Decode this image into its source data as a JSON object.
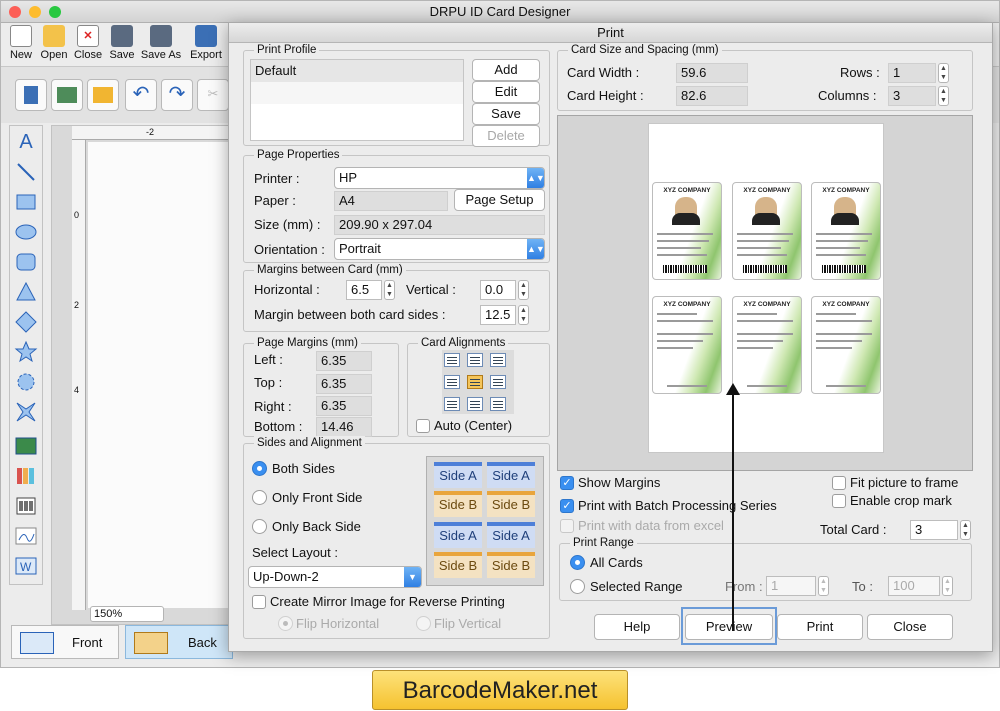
{
  "app": {
    "title": "DRPU ID Card Designer",
    "toolbar": [
      "New",
      "Open",
      "Close",
      "Save",
      "Save As",
      "Export"
    ],
    "ruler_labels": [
      "-2",
      "0",
      "2",
      "4"
    ],
    "zoom": "150%",
    "tabs": {
      "front": "Front",
      "back": "Back"
    }
  },
  "dialog": {
    "title": "Print",
    "print_profile": {
      "legend": "Print Profile",
      "items": [
        "Default"
      ],
      "buttons": {
        "add": "Add",
        "edit": "Edit",
        "save": "Save",
        "delete": "Delete"
      }
    },
    "page_properties": {
      "legend": "Page Properties",
      "printer_label": "Printer :",
      "printer": "HP",
      "paper_label": "Paper :",
      "paper": "A4",
      "page_setup": "Page Setup",
      "size_label": "Size (mm) :",
      "size": "209.90 x 297.04",
      "orientation_label": "Orientation :",
      "orientation": "Portrait"
    },
    "margins_between": {
      "legend": "Margins between Card (mm)",
      "horizontal_label": "Horizontal :",
      "horizontal": "6.5",
      "vertical_label": "Vertical :",
      "vertical": "0.0",
      "both_sides_label": "Margin between both card sides :",
      "both_sides": "12.5"
    },
    "page_margins": {
      "legend": "Page Margins (mm)",
      "left_label": "Left :",
      "left": "6.35",
      "top_label": "Top :",
      "top": "6.35",
      "right_label": "Right :",
      "right": "6.35",
      "bottom_label": "Bottom :",
      "bottom": "14.46"
    },
    "card_alignments": {
      "legend": "Card Alignments",
      "auto_center": "Auto (Center)",
      "selected_index": 4
    },
    "sides": {
      "legend": "Sides and Alignment",
      "both": "Both Sides",
      "front_only": "Only Front Side",
      "back_only": "Only Back Side",
      "selected": "both",
      "layout_label": "Select Layout :",
      "layout": "Up-Down-2",
      "preview_cells": [
        "Side A",
        "Side A",
        "Side B",
        "Side B",
        "Side A",
        "Side A",
        "Side B",
        "Side B"
      ],
      "mirror_label": "Create Mirror Image for Reverse Printing",
      "flip_h": "Flip Horizontal",
      "flip_v": "Flip Vertical"
    },
    "card_size": {
      "legend": "Card Size and Spacing (mm)",
      "width_label": "Card Width :",
      "width": "59.6",
      "height_label": "Card Height :",
      "height": "82.6",
      "rows_label": "Rows :",
      "rows": "1",
      "columns_label": "Columns :",
      "columns": "3"
    },
    "preview_cards": {
      "company": "XYZ COMPANY",
      "front_lines": [
        "Employee Name : Chester Shaw",
        "Designation : Project Manager",
        "Unique No. : 9012501",
        "Phone No. : (802) 598 9240"
      ],
      "back_lines": [
        "Fax no. : 1970-5621",
        "Email : chestershaw12@abc mail.com",
        "Address : P.O. Box 242 4978 SE St. Yigo Massachusetts 50634"
      ],
      "website": "Website : www.xyzcompany.com"
    },
    "options": {
      "show_margins": "Show Margins",
      "batch": "Print with Batch Processing Series",
      "data_excel": "Print with data from excel",
      "fit_picture": "Fit picture to frame",
      "crop_mark": "Enable crop mark",
      "total_card_label": "Total Card :",
      "total_card": "3"
    },
    "print_range": {
      "legend": "Print Range",
      "all": "All Cards",
      "selected": "Selected Range",
      "from_label": "From :",
      "from": "1",
      "to_label": "To :",
      "to": "100"
    },
    "buttons": {
      "help": "Help",
      "preview": "Preview",
      "print": "Print",
      "close": "Close"
    }
  },
  "watermark": "BarcodeMaker.net"
}
